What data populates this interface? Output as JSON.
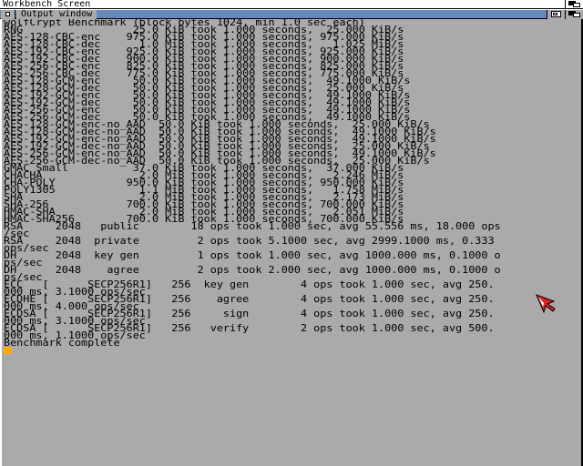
{
  "screen": {
    "title": "Workbench Screen"
  },
  "window": {
    "title": "Output window"
  },
  "console": {
    "lines": [
      "wolfCrypt Benchmark (block bytes 1024, min 1.0 sec each)",
      "RNG                 25.0 KiB took 1.000 seconds,  25.000 KiB/s",
      "AES-128-CBC-enc    975.0 KiB took 1.000 seconds, 975.000 KiB/s",
      "AES-128-CBC-dec      1.0 MiB took 1.000 seconds,   1.025 MiB/s",
      "AES-192-CBC-enc    925.0 KiB took 1.000 seconds, 925.000 KiB/s",
      "AES-192-CBC-dec    900.0 KiB took 1.000 seconds, 900.000 KiB/s",
      "AES-256-CBC-enc    825.0 KiB took 1.000 seconds, 825.000 KiB/s",
      "AES-256-CBC-dec    775.0 KiB took 1.000 seconds, 775.000 KiB/s",
      "AES-128-GCM-enc     50.0 KiB took 1.000 seconds,  49.1000 KiB/s",
      "AES-128-GCM-dec     50.0 KiB took 1.000 seconds,  25.000 KiB/s",
      "AES-192-GCM-enc     50.0 KiB took 1.000 seconds,  49.1000 KiB/s",
      "AES-192-GCM-dec     50.0 KiB took 1.000 seconds,  49.1000 KiB/s",
      "AES-256-GCM-enc     50.0 KiB took 1.000 seconds,  49.1000 KiB/s",
      "AES-256-GCM-dec     50.0 KiB took 1.000 seconds,  49.1000 KiB/s",
      "AES-128-GCM-enc-no_AAD  50.0 KiB took 1.000 seconds,  25.000 KiB/s",
      "AES-128-GCM-dec-no_AAD  50.0 KiB took 1.000 seconds,  49.1000 KiB/s",
      "AES-192-GCM-enc-no_AAD  50.0 KiB took 1.000 seconds,  49.1000 KiB/s",
      "AES-192-GCM-dec-no_AAD  50.0 KiB took 1.000 seconds,  25.000 KiB/s",
      "AES-256-GCM-enc-no_AAD  50.0 KiB took 1.000 seconds,  49.1000 KiB/s",
      "AES-256-GCM-dec-no_AAD  50.0 KiB took 1.000 seconds,  25.000 KiB/s",
      "GMAC Small          37.0 KiB took 1.000 seconds,  37.000 KiB/s",
      "CHACHA               2.0 MiB took 1.000 seconds,   2.246 MiB/s",
      "CHA-POLY           950.0 KiB took 1.000 seconds, 950.000 KiB/s",
      "POLY1305             1.1 MiB took 1.000 seconds,   1.758 MiB/s",
      "SHA                  2.0 MiB took 1.000 seconds,   2.173 MiB/s",
      "SHA-256            700.0 KiB took 1.000 seconds, 700.000 KiB/s",
      "HMAC-SHA             2.0 MiB took 1.000 seconds,   2.051 MiB/s",
      "HMAC-SHA256        700.0 KiB took 1.000 seconds, 700.000 KiB/s",
      "RSA     2048   public        18 ops took 1.000 sec, avg 55.556 ms, 18.000 ops",
      "/sec",
      "RSA     2048  private         2 ops took 5.1000 sec, avg 2999.1000 ms, 0.333",
      "ops/sec",
      "DH      2048  key gen         1 ops took 1.000 sec, avg 1000.000 ms, 0.1000 o",
      "ps/sec",
      "DH      2048    agree         2 ops took 2.000 sec, avg 1000.000 ms, 0.1000 o",
      "ps/sec",
      "ECC   [      SECP256R1]   256  key gen        4 ops took 1.000 sec, avg 250.",
      "000 ms, 3.1000 ops/sec",
      "ECDHE [      SECP256R1]   256    agree        4 ops took 1.000 sec, avg 250.",
      "000 ms, 4.000 ops/sec",
      "ECDSA [      SECP256R1]   256     sign        4 ops took 1.000 sec, avg 250.",
      "000 ms, 3.1000 ops/sec",
      "ECDSA [      SECP256R1]   256   verify        2 ops took 1.000 sec, avg 500.",
      "000 ms, 1.1000 ops/sec",
      "Benchmark complete"
    ]
  },
  "colors": {
    "background": "#aaaaaa",
    "text": "#000000",
    "title_bar": "#6688bb",
    "cursor": "#ffaa00",
    "pointer_fill": "#dd2222"
  },
  "icons": {
    "screen_depth": "screen-depth-icon",
    "close": "close-icon",
    "zoom": "zoom-icon",
    "depth": "depth-icon",
    "pointer": "mouse-pointer-icon"
  }
}
